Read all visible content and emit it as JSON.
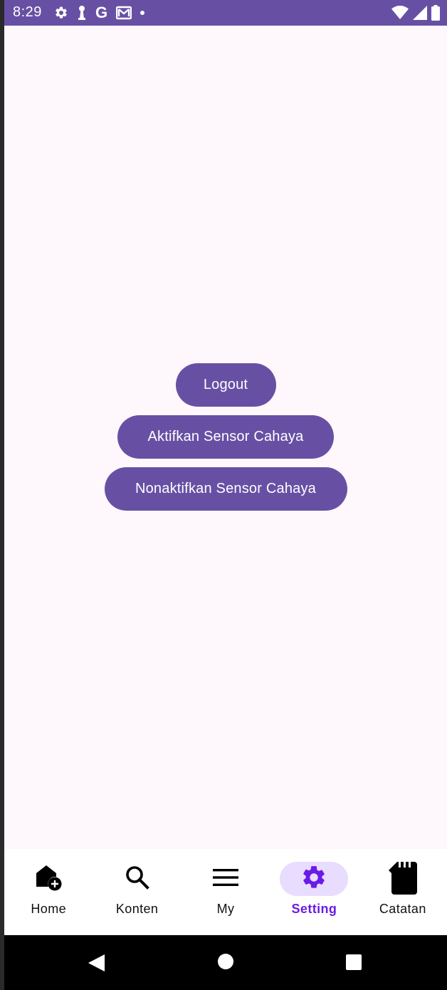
{
  "status_bar": {
    "time": "8:29",
    "g_label": "G",
    "background_color": "#6750a4",
    "left_icons": [
      "settings-icon",
      "lock-icon",
      "google-icon",
      "gmail-icon",
      "dot-icon"
    ],
    "right_icons": [
      "wifi-icon",
      "signal-icon",
      "battery-icon"
    ]
  },
  "actions": {
    "logout_label": "Logout",
    "activate_sensor_label": "Aktifkan Sensor Cahaya",
    "deactivate_sensor_label": "Nonaktifkan Sensor Cahaya",
    "button_color": "#6750a4"
  },
  "bottom_nav": {
    "items": [
      {
        "label": "Home",
        "icon": "home-add-icon",
        "active": false
      },
      {
        "label": "Konten",
        "icon": "search-icon",
        "active": false
      },
      {
        "label": "My",
        "icon": "menu-icon",
        "active": false
      },
      {
        "label": "Setting",
        "icon": "gear-icon",
        "active": true
      },
      {
        "label": "Catatan",
        "icon": "sd-card-icon",
        "active": false
      }
    ],
    "active_color": "#6a1be6",
    "active_indicator_color": "#e8ddff"
  },
  "system_nav": {
    "icons": [
      "back-icon",
      "home-circle-icon",
      "recents-icon"
    ]
  }
}
